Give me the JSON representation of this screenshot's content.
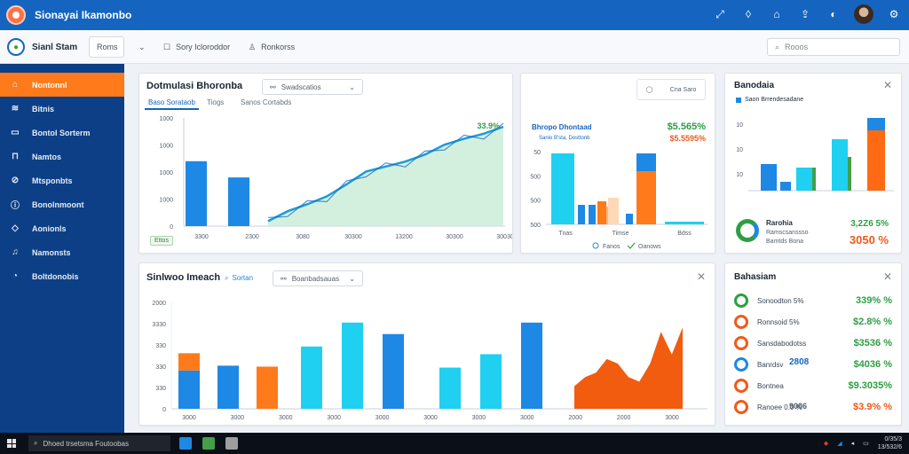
{
  "topbar": {
    "title": "Sionayai Ikamonbo",
    "icons": [
      "app-logo",
      "expand-icon",
      "shield-icon",
      "home-icon",
      "upload-icon",
      "moon-icon",
      "avatar",
      "settings-icon"
    ]
  },
  "subbar": {
    "brand": "Sianl Stam",
    "button1": "Roms",
    "button2": "Sory Icloroddor",
    "button3": "Ronkorss",
    "search_placeholder": "Rooos"
  },
  "sidebar": {
    "items": [
      {
        "label": "Nontonnl",
        "icon": "home-icon"
      },
      {
        "label": "Bitnis",
        "icon": "chart-icon"
      },
      {
        "label": "Bontol Sorterm",
        "icon": "document-icon"
      },
      {
        "label": "Namtos",
        "icon": "bag-icon"
      },
      {
        "label": "Mtsponbts",
        "icon": "compass-icon"
      },
      {
        "label": "Bonolnmoont",
        "icon": "info-icon"
      },
      {
        "label": "Aonionls",
        "icon": "shield-icon"
      },
      {
        "label": "Namonsts",
        "icon": "bell-icon"
      },
      {
        "label": "Boltdonobis",
        "icon": "clock-icon"
      }
    ]
  },
  "main_chart": {
    "title": "Dotmulasi Bhoronba",
    "dropdown": "Swadscatios",
    "tabs": [
      "Baso Sorataob",
      "Tiogs",
      "Sanos Cortabds"
    ],
    "badge": "Ettos",
    "colors": {
      "bar": "#1e88e5",
      "line": "#1e9bd7",
      "area": "#c8ecd6"
    }
  },
  "mini_chart": {
    "title": "Bhropo Dhontaad",
    "subtitle": "Sanio B'sta, Dosttonb",
    "kpi_top": "$5.565%",
    "kpi_bottom": "$5.5595%",
    "ticks_y": [
      "50",
      "500",
      "500",
      "500"
    ],
    "ticks_x": [
      "Tnas",
      "Timse",
      "Bdss"
    ],
    "legend": [
      "Fanos",
      "Oanows"
    ],
    "button": "Cna Saro"
  },
  "right_top": {
    "title": "Banodaia",
    "legend": "Saon Brrendesadane",
    "ticks_y": [
      "10",
      "10",
      "10"
    ],
    "list_title": "Rarohia",
    "list_sub": "Ramscsanssso",
    "list_sub2": "Bamtds Bona",
    "value_green": "3,2Z6 5%",
    "value_orange": "3050 %"
  },
  "bottom_chart": {
    "title": "Sinlwoo Imeach",
    "filter": "Sortan",
    "dropdown": "Boanbadsauas"
  },
  "right_bottom": {
    "title": "Bahasiam",
    "items": [
      {
        "name": "Sonoodton 5%",
        "value": "339% %",
        "color": "#2e9e44",
        "icon_color": "#2e9e44"
      },
      {
        "name": "Ronnsoid 5%",
        "value": "$2.8% %",
        "color": "#2e9e44",
        "icon_color": "#f05a1a"
      },
      {
        "name": "Sansdabodotss",
        "value": "$3536 %",
        "color": "#2e9e44",
        "icon_color": "#f05a1a"
      },
      {
        "name": "Banrdsv",
        "value": "$4036 %",
        "color": "#2e9e44",
        "icon_color": "#1e88e5"
      },
      {
        "name": "Bontnea",
        "value": "$9.3035%",
        "color": "#2e9e44",
        "icon_color": "#f05a1a"
      },
      {
        "name": "Ranoee 0.0 %",
        "value": "$3.9% %",
        "color": "#f05a1a",
        "icon_color": "#f05a1a"
      }
    ],
    "mid_value": "2808",
    "mid_value2": "9006"
  },
  "taskbar": {
    "search_text": "Dhoed trsetsma Foutoobas",
    "clock": "0/35/3",
    "date": "13/532/6"
  },
  "chart_data": [
    {
      "type": "bar+area",
      "title": "Dotmulasi Bhoronba",
      "y_ticks": [
        "1000",
        "1000",
        "1000",
        "1000",
        "0"
      ],
      "x_ticks": [
        "3300",
        "2300",
        "3080",
        "30300",
        "13200",
        "30300",
        "30030"
      ],
      "bars": [
        {
          "x": "3300",
          "value": 600
        },
        {
          "x": "2300",
          "value": 450
        }
      ],
      "line": [
        0.05,
        0.15,
        0.22,
        0.3,
        0.42,
        0.55,
        0.6,
        0.65,
        0.72,
        0.82,
        0.88,
        0.93,
        1.0
      ],
      "percent_label": "33.9%"
    },
    {
      "type": "bar",
      "title": "Sinlwoo Imeach",
      "y_ticks": [
        "2000",
        "3330",
        "330",
        "330",
        "330",
        "0"
      ],
      "x_ticks": [
        "3000",
        "3000",
        "3000",
        "3000",
        "3000",
        "3000",
        "3000",
        "3000",
        "2000",
        "2000",
        "3000"
      ],
      "series": [
        {
          "name": "blue",
          "values": [
            0.4,
            0.45,
            0,
            0.65,
            0.9,
            0.78,
            0.43,
            0.57,
            0.9
          ]
        },
        {
          "name": "orange",
          "values": [
            0.58,
            0,
            0.44,
            0,
            0,
            0,
            0,
            0,
            0
          ]
        }
      ],
      "area": [
        0.25,
        0.35,
        0.4,
        0.55,
        0.5,
        0.35,
        0.3,
        0.5,
        0.85,
        0.6,
        0.9
      ]
    }
  ]
}
